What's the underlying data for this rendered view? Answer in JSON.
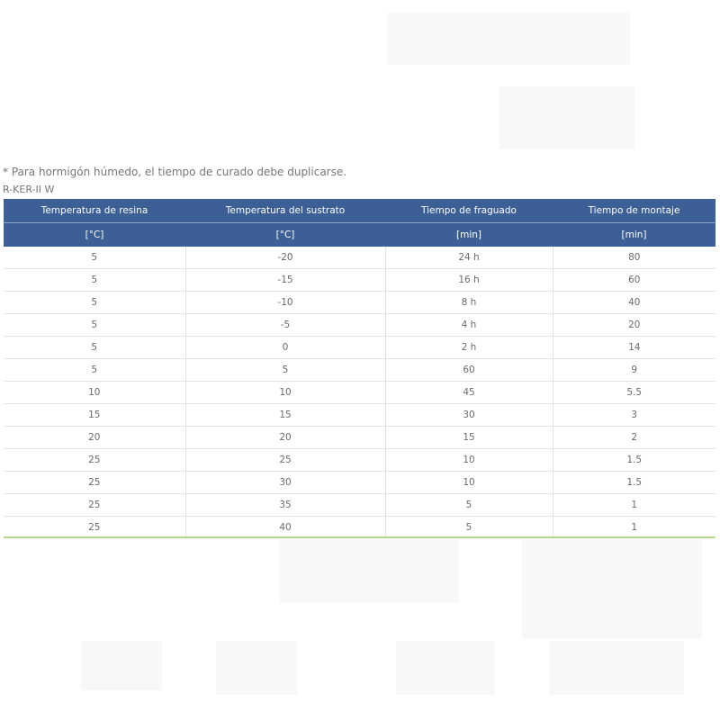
{
  "note": "* Para hormigón húmedo, el tiempo de curado debe duplicarse.",
  "product": "R-KER-II W",
  "table": {
    "headers": [
      "Temperatura de resina",
      "Temperatura del sustrato",
      "Tiempo de fraguado",
      "Tiempo de montaje"
    ],
    "units": [
      "[°C]",
      "[°C]",
      "[min]",
      "[min]"
    ],
    "rows": [
      [
        "5",
        "-20",
        "24 h",
        "80"
      ],
      [
        "5",
        "-15",
        "16 h",
        "60"
      ],
      [
        "5",
        "-10",
        "8 h",
        "40"
      ],
      [
        "5",
        "-5",
        "4 h",
        "20"
      ],
      [
        "5",
        "0",
        "2 h",
        "14"
      ],
      [
        "5",
        "5",
        "60",
        "9"
      ],
      [
        "10",
        "10",
        "45",
        "5.5"
      ],
      [
        "15",
        "15",
        "30",
        "3"
      ],
      [
        "20",
        "20",
        "15",
        "2"
      ],
      [
        "25",
        "25",
        "10",
        "1.5"
      ],
      [
        "25",
        "30",
        "10",
        "1.5"
      ],
      [
        "25",
        "35",
        "5",
        "1"
      ],
      [
        "25",
        "40",
        "5",
        "1"
      ]
    ]
  }
}
